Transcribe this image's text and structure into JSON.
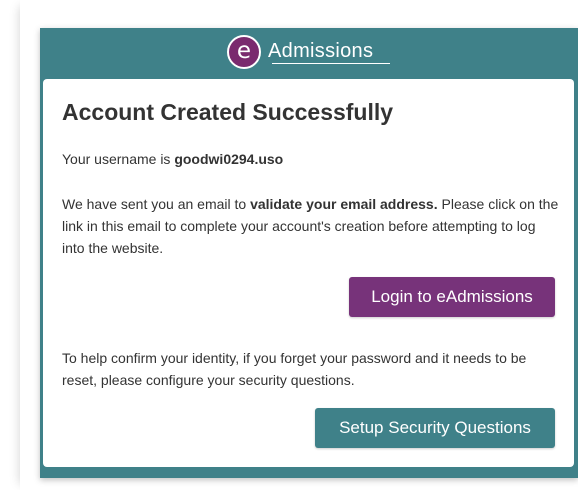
{
  "header": {
    "logo_letter": "e",
    "logo_text": "Admissions"
  },
  "card": {
    "title": "Account Created Successfully",
    "username_prefix": "Your username is ",
    "username": "goodwi0294.uso",
    "email_para": {
      "before": "We have sent you an email to ",
      "bold": "validate your email address.",
      "after": " Please click on the link in this email to complete your account's creation before attempting to log into the website."
    },
    "login_button": "Login to eAdmissions",
    "security_para": "To help confirm your identity, if you forget your password and it needs to be reset, please configure your security questions.",
    "security_button": "Setup Security Questions"
  },
  "colors": {
    "frame_teal": "#3f8189",
    "login_purple": "#77337a",
    "logo_purple": "#7a2a6e",
    "text_dark": "#333333"
  }
}
